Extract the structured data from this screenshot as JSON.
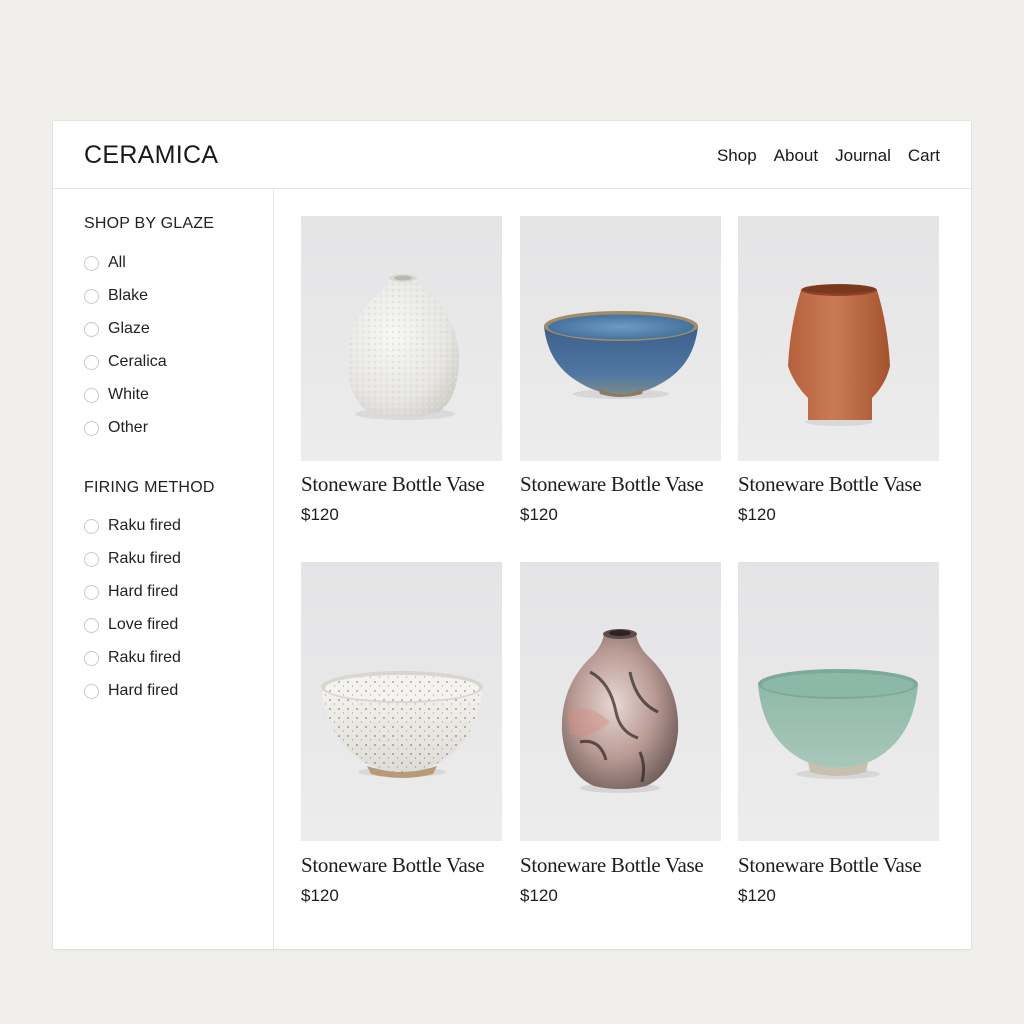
{
  "header": {
    "brand": "CERAMICA",
    "nav": [
      "Shop",
      "About",
      "Journal",
      "Cart"
    ]
  },
  "sidebar": {
    "glaze_title": "SHOP BY GLAZE",
    "glaze_options": [
      "All",
      "Blake",
      "Glaze",
      "Ceralica",
      "White",
      "Other"
    ],
    "firing_title": "FIRING METHOD",
    "firing_options": [
      "Raku fired",
      "Raku fired",
      "Hard fired",
      "Love fired",
      "Raku fired",
      "Hard fired"
    ]
  },
  "products": [
    {
      "title": "Stoneware Bottle Vase",
      "price": "$120",
      "image": "white-textured-vase"
    },
    {
      "title": "Stoneware Bottle Vase",
      "price": "$120",
      "image": "blue-glazed-bowl"
    },
    {
      "title": "Stoneware Bottle Vase",
      "price": "$120",
      "image": "terracotta-cup"
    },
    {
      "title": "Stoneware Bottle Vase",
      "price": "$120",
      "image": "speckled-white-bowl"
    },
    {
      "title": "Stoneware Bottle Vase",
      "price": "$120",
      "image": "raku-vase"
    },
    {
      "title": "Stoneware Bottle Vase",
      "price": "$120",
      "image": "celadon-bowl"
    }
  ],
  "colors": {
    "page_bg": "#f0efec",
    "panel_bg": "#ffffff",
    "divider": "#e6e6e6",
    "text": "#1c1c1c",
    "radio_border": "#c9c9c9"
  }
}
